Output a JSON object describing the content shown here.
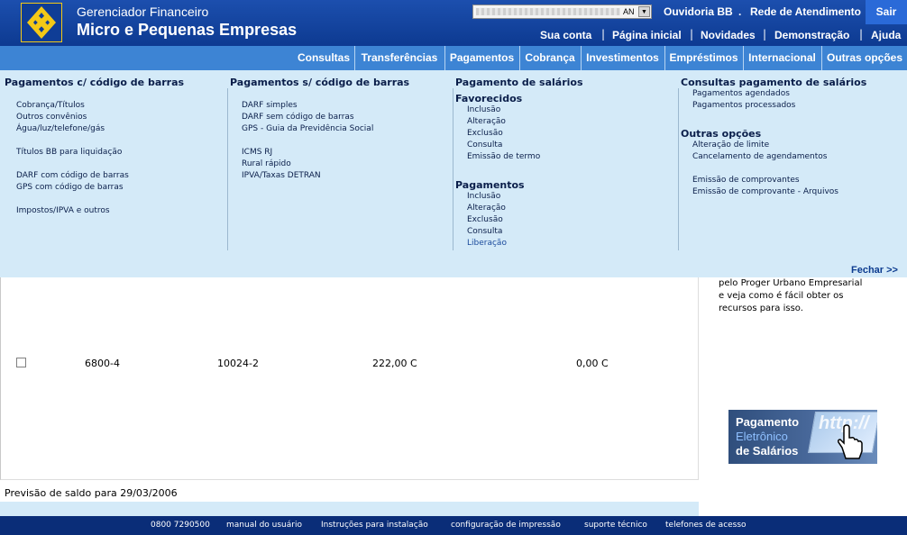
{
  "header": {
    "app_name": "Gerenciador Financeiro",
    "app_subtitle": "Micro e Pequenas Empresas",
    "lang_selected": "AN",
    "top_links": [
      "Ouvidoria BB",
      ".",
      "Rede de Atendimento"
    ],
    "exit_label": "Sair",
    "sub_links": [
      "Sua conta",
      "Página inicial",
      "Novidades",
      "Demonstração",
      "Ajuda"
    ],
    "separator": "|"
  },
  "nav": {
    "tabs": [
      "Consultas",
      "Transferências",
      "Pagamentos",
      "Cobrança",
      "Investimentos",
      "Empréstimos",
      "Internacional",
      "Outras opções"
    ]
  },
  "menu": {
    "col1": {
      "title": "Pagamentos c/ código de barras",
      "items": [
        "Cobrança/Títulos",
        "Outros convênios",
        "Água/luz/telefone/gás",
        "Títulos BB para liquidação",
        "DARF com código de barras",
        "GPS com código de barras",
        "Impostos/IPVA e outros"
      ]
    },
    "col2": {
      "title": "Pagamentos s/ código de barras",
      "items": [
        "DARF simples",
        "DARF sem código de barras",
        "GPS - Guia da Previdência Social",
        "ICMS RJ",
        "Rural rápido",
        "IPVA/Taxas DETRAN"
      ]
    },
    "col3": {
      "title": "Pagamento de salários",
      "favorecidos_title": "Favorecidos",
      "favorecidos": [
        "Inclusão",
        "Alteração",
        "Exclusão",
        "Consulta",
        "Emissão de termo"
      ],
      "pagamentos_title": "Pagamentos",
      "pagamentos": [
        "Inclusão",
        "Alteração",
        "Exclusão",
        "Consulta",
        "Liberação"
      ]
    },
    "col4": {
      "title": "Consultas pagamento de salários",
      "items": [
        "Pagamentos agendados",
        "Pagamentos processados"
      ],
      "outras_title": "Outras opções",
      "outras": [
        "Alteração de limite",
        "Cancelamento de agendamentos",
        "Emissão de comprovantes",
        "Emissão de comprovante - Arquivos"
      ]
    },
    "close_label": "Fechar >>"
  },
  "content": {
    "row": {
      "agencia": "6800-4",
      "conta": "10024-2",
      "saldo": "222,00 C",
      "limite": "0,00 C"
    },
    "previsao": "Previsão de saldo para 29/03/2006"
  },
  "promo": {
    "lines": [
      "pelo Proger Urbano Empresarial",
      "e veja como é fácil obter os",
      "recursos para isso."
    ],
    "banner": {
      "line1": "Pagamento",
      "line2": "Eletrônico",
      "line3": "de Salários",
      "http": "http://"
    }
  },
  "footer": {
    "links": [
      "0800 7290500",
      "manual do usuário",
      "Instruções para instalação",
      "configuração de impressão",
      "suporte técnico",
      "telefones de acesso"
    ]
  },
  "colors": {
    "header_blue": "#0d3a91",
    "nav_blue": "#3d84d4",
    "menu_bg": "#d4eaf8",
    "footer_blue": "#0a2d78",
    "logo_yellow": "#f4c916"
  }
}
